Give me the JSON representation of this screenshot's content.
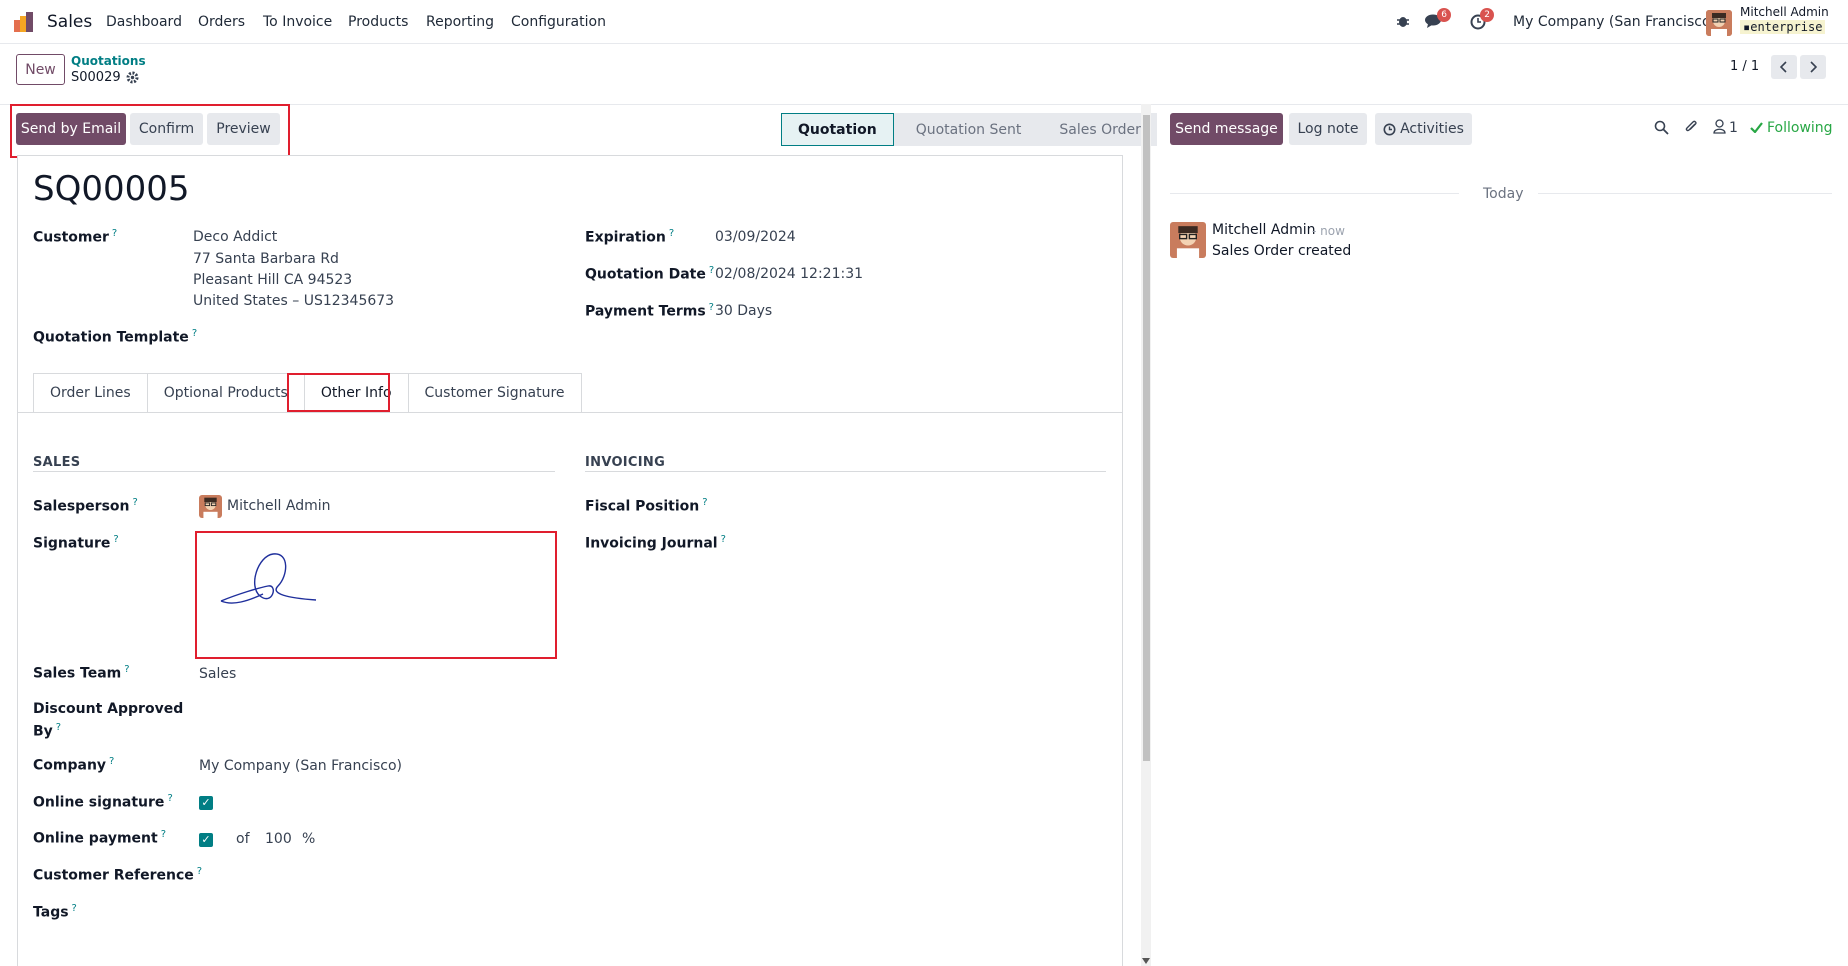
{
  "navbar": {
    "app_name": "Sales",
    "menu": [
      "Dashboard",
      "Orders",
      "To Invoice",
      "Products",
      "Reporting",
      "Configuration"
    ],
    "messages_badge": "6",
    "activities_badge": "2",
    "company": "My Company (San Francisco)",
    "user_name": "Mitchell Admin",
    "db_name": "enterprise"
  },
  "breadcrumb": {
    "new_label": "New",
    "parent": "Quotations",
    "current": "S00029",
    "pager": "1 / 1"
  },
  "actions": {
    "send_email": "Send by Email",
    "confirm": "Confirm",
    "preview": "Preview"
  },
  "status": {
    "stages": [
      "Quotation",
      "Quotation Sent",
      "Sales Order"
    ],
    "active": "Quotation"
  },
  "form": {
    "title": "SQ00005",
    "customer_label": "Customer",
    "customer_lines": [
      "Deco Addict",
      "77 Santa Barbara Rd",
      "Pleasant Hill CA 94523",
      "United States – US12345673"
    ],
    "expiration_label": "Expiration",
    "expiration": "03/09/2024",
    "quotation_date_label": "Quotation Date",
    "quotation_date": "02/08/2024 12:21:31",
    "payment_terms_label": "Payment Terms",
    "payment_terms": "30 Days",
    "template_label": "Quotation Template",
    "tooltip": "?"
  },
  "tabs": [
    "Order Lines",
    "Optional Products",
    "Other Info",
    "Customer Signature"
  ],
  "other_info": {
    "sales_title": "SALES",
    "invoicing_title": "INVOICING",
    "salesperson_label": "Salesperson",
    "salesperson": "Mitchell Admin",
    "signature_label": "Signature",
    "sales_team_label": "Sales Team",
    "sales_team": "Sales",
    "discount_label_1": "Discount Approved",
    "discount_label_2": "By",
    "company_label": "Company",
    "company": "My Company (San Francisco)",
    "online_signature_label": "Online signature",
    "online_payment_label": "Online payment",
    "payment_of": "of",
    "payment_percent": "100",
    "percent_sign": "%",
    "customer_ref_label": "Customer Reference",
    "tags_label": "Tags",
    "fiscal_position_label": "Fiscal Position",
    "invoicing_journal_label": "Invoicing Journal"
  },
  "chatter": {
    "send_message": "Send message",
    "log_note": "Log note",
    "activities": "Activities",
    "followers_count": "1",
    "following": "Following",
    "date_separator": "Today",
    "author": "Mitchell Admin",
    "time": "- now",
    "message": "Sales Order created"
  },
  "colors": {
    "primary": "#714b67",
    "teal": "#017e84",
    "highlight": "#e01e2e",
    "badge": "#d9534f",
    "following": "#28a745"
  },
  "icons": [
    "odoo-logo-icon",
    "bug-icon",
    "chat-icon",
    "clock-icon",
    "gear-icon",
    "chevron-left-icon",
    "chevron-right-icon",
    "search-icon",
    "paperclip-icon",
    "user-icon",
    "check-icon",
    "scroll-down-icon"
  ]
}
